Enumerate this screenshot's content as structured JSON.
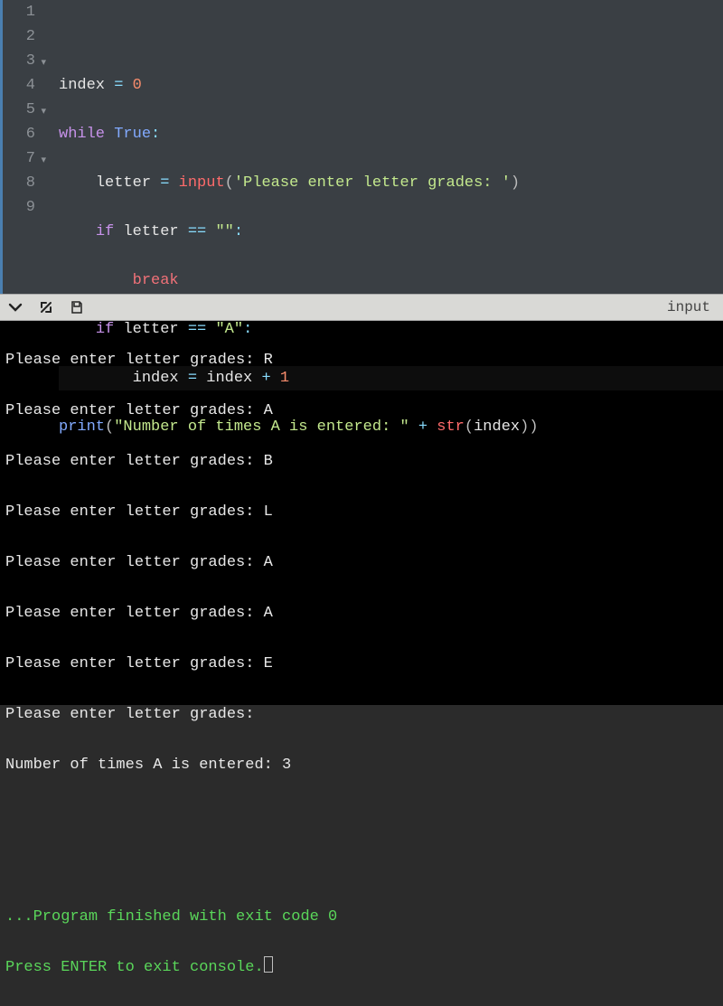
{
  "editor": {
    "lines": [
      "1",
      "2",
      "3",
      "4",
      "5",
      "6",
      "7",
      "8",
      "9"
    ],
    "foldable": [
      3,
      5,
      7
    ],
    "highlighted_line": 8,
    "code": {
      "l2": {
        "a": "index",
        "b": "=",
        "c": "0"
      },
      "l3": {
        "a": "while",
        "b": "True",
        "c": ":"
      },
      "l4": {
        "a": "letter",
        "b": "=",
        "c": "input",
        "d": "(",
        "e": "'Please enter letter grades: '",
        "f": ")"
      },
      "l5": {
        "a": "if",
        "b": "letter",
        "c": "==",
        "d": "\"\"",
        "e": ":"
      },
      "l6": {
        "a": "break"
      },
      "l7": {
        "a": "if",
        "b": "letter",
        "c": "==",
        "d": "\"A\"",
        "e": ":"
      },
      "l8": {
        "a": "index",
        "b": "=",
        "c": "index",
        "d": "+",
        "e": "1"
      },
      "l9": {
        "a": "print",
        "b": "(",
        "c": "\"Number of times A is entered: \"",
        "d": "+",
        "e": "str",
        "f": "(",
        "g": "index",
        "h": ")",
        "i": ")"
      }
    }
  },
  "toolbar": {
    "input_label": "input"
  },
  "console": {
    "lines": [
      "Please enter letter grades: R",
      "Please enter letter grades: A",
      "Please enter letter grades: B",
      "Please enter letter grades: L",
      "Please enter letter grades: A",
      "Please enter letter grades: A",
      "Please enter letter grades: E",
      "Please enter letter grades: ",
      "Number of times A is entered: 3"
    ],
    "finish1": "...Program finished with exit code 0",
    "finish2": "Press ENTER to exit console."
  }
}
